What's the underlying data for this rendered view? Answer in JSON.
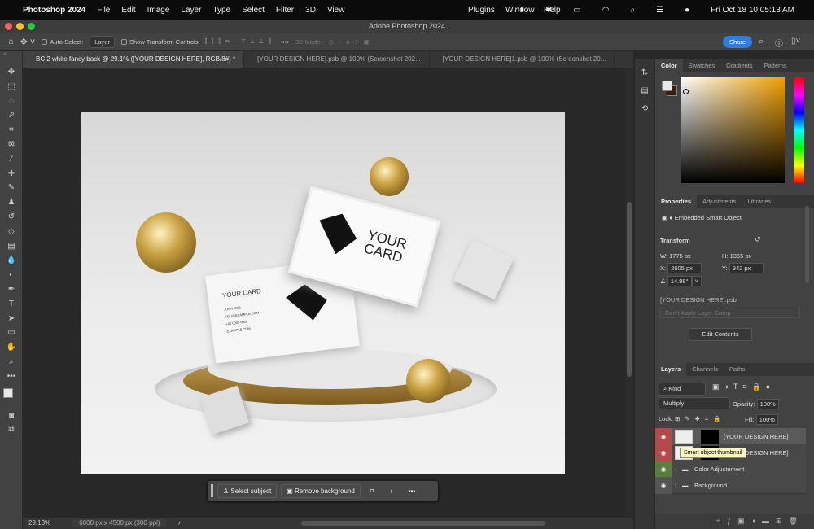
{
  "menubar": {
    "app": "Photoshop 2024",
    "items": [
      "File",
      "Edit",
      "Image",
      "Layer",
      "Type",
      "Select",
      "Filter",
      "3D",
      "View"
    ],
    "right_items": [
      "Plugins",
      "Window",
      "Help"
    ],
    "clock": "Fri Oct 18  10:05:13 AM"
  },
  "window": {
    "title": "Adobe Photoshop 2024"
  },
  "options": {
    "auto_select": "Auto-Select:",
    "layer_select": "Layer",
    "show_transform": "Show Transform Controls",
    "mode_3d": "3D Mode:",
    "share": "Share"
  },
  "tabs": [
    {
      "label": "BC 2 white fancy back @ 29.1% ([YOUR DESIGN HERE], RGB/8#) *"
    },
    {
      "label": "[YOUR DESIGN HERE].psb @ 100% (Screenshot 202..."
    },
    {
      "label": "[YOUR DESIGN HERE]1.psb @ 100% (Screenshot 20..."
    }
  ],
  "canvas": {
    "card_front": "YOUR\nCARD",
    "card_back_title": "YOUR CARD",
    "card_lines": [
      "JOHN DOE",
      "YOU@EXAMPLE.COM",
      "+00 0000 0000",
      "EXAMPLE.COM"
    ]
  },
  "context_bar": {
    "select_subject": "Select subject",
    "remove_background": "Remove background"
  },
  "status": {
    "zoom": "29.13%",
    "doc_size": "6000 px x 4500 px (300 ppi)"
  },
  "color_panel": {
    "tabs": [
      "Color",
      "Swatches",
      "Gradients",
      "Patterns"
    ],
    "foreground": "#e8e8e8",
    "background": "#3a1e0a",
    "hue": "#f0a000"
  },
  "properties": {
    "tabs": [
      "Properties",
      "Adjustments",
      "Libraries"
    ],
    "type": "Embedded Smart Object",
    "transform_label": "Transform",
    "w": "W:  1775 px",
    "h": "H:  1365 px",
    "x_label": "X:",
    "x": "2605 px",
    "y_label": "Y:",
    "y": "942 px",
    "angle": "14.98°",
    "file": "[YOUR DESIGN HERE].psb",
    "layer_comp": "Don't Apply Layer Comp",
    "edit_contents": "Edit Contents"
  },
  "layers": {
    "tabs": [
      "Layers",
      "Channels",
      "Paths"
    ],
    "kind": "Kind",
    "blend": "Multiply",
    "opacity_label": "Opacity:",
    "opacity": "100%",
    "lock_label": "Lock:",
    "fill_label": "Fill:",
    "fill": "100%",
    "tooltip": "Smart object thumbnail",
    "items": [
      {
        "name": "[YOUR DESIGN HERE]",
        "color": "#b34a4a",
        "selected": true
      },
      {
        "name": "[YOUR DESIGN HERE]",
        "color": "#b34a4a",
        "selected": false
      },
      {
        "name": "Color Adjustement",
        "color": "#5a7f3d",
        "group": true
      },
      {
        "name": "Background",
        "color": "#555555",
        "group": true
      }
    ]
  }
}
